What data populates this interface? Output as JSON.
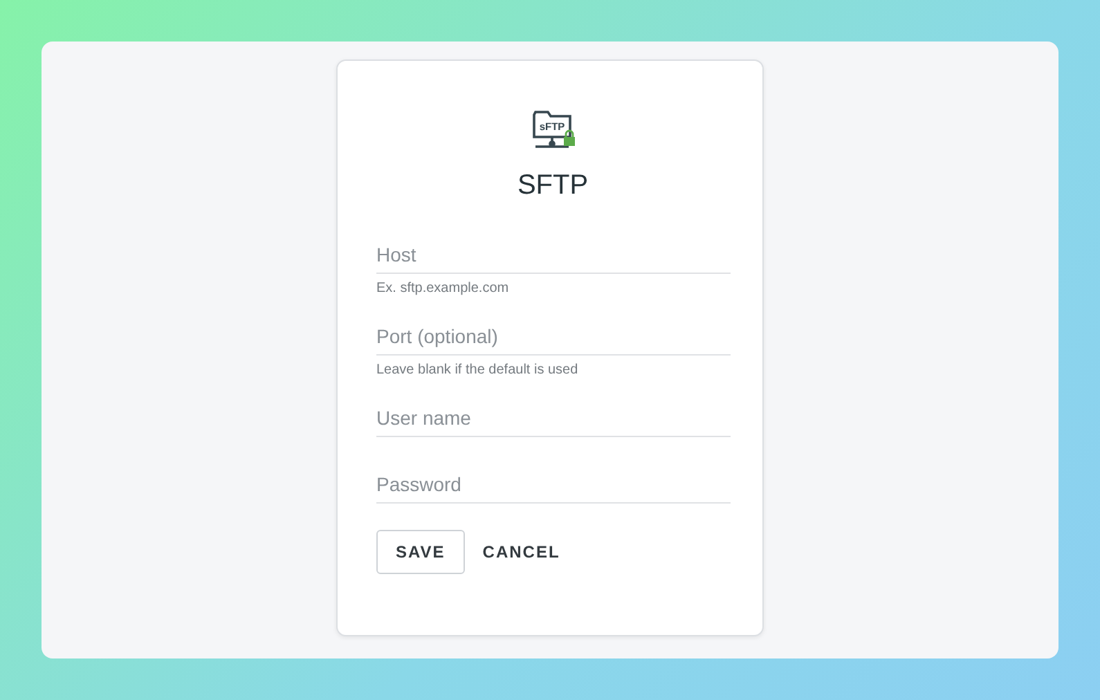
{
  "dialog": {
    "logo_text": "sFTP",
    "title": "SFTP"
  },
  "fields": [
    {
      "placeholder": "Host",
      "hint": "Ex. sftp.example.com"
    },
    {
      "placeholder": "Port (optional)",
      "hint": "Leave blank if the default is used"
    },
    {
      "placeholder": "User name"
    },
    {
      "placeholder": "Password"
    }
  ],
  "buttons": [
    {
      "label": "SAVE",
      "kind": "outlined"
    },
    {
      "label": "CANCEL",
      "kind": "text"
    }
  ]
}
